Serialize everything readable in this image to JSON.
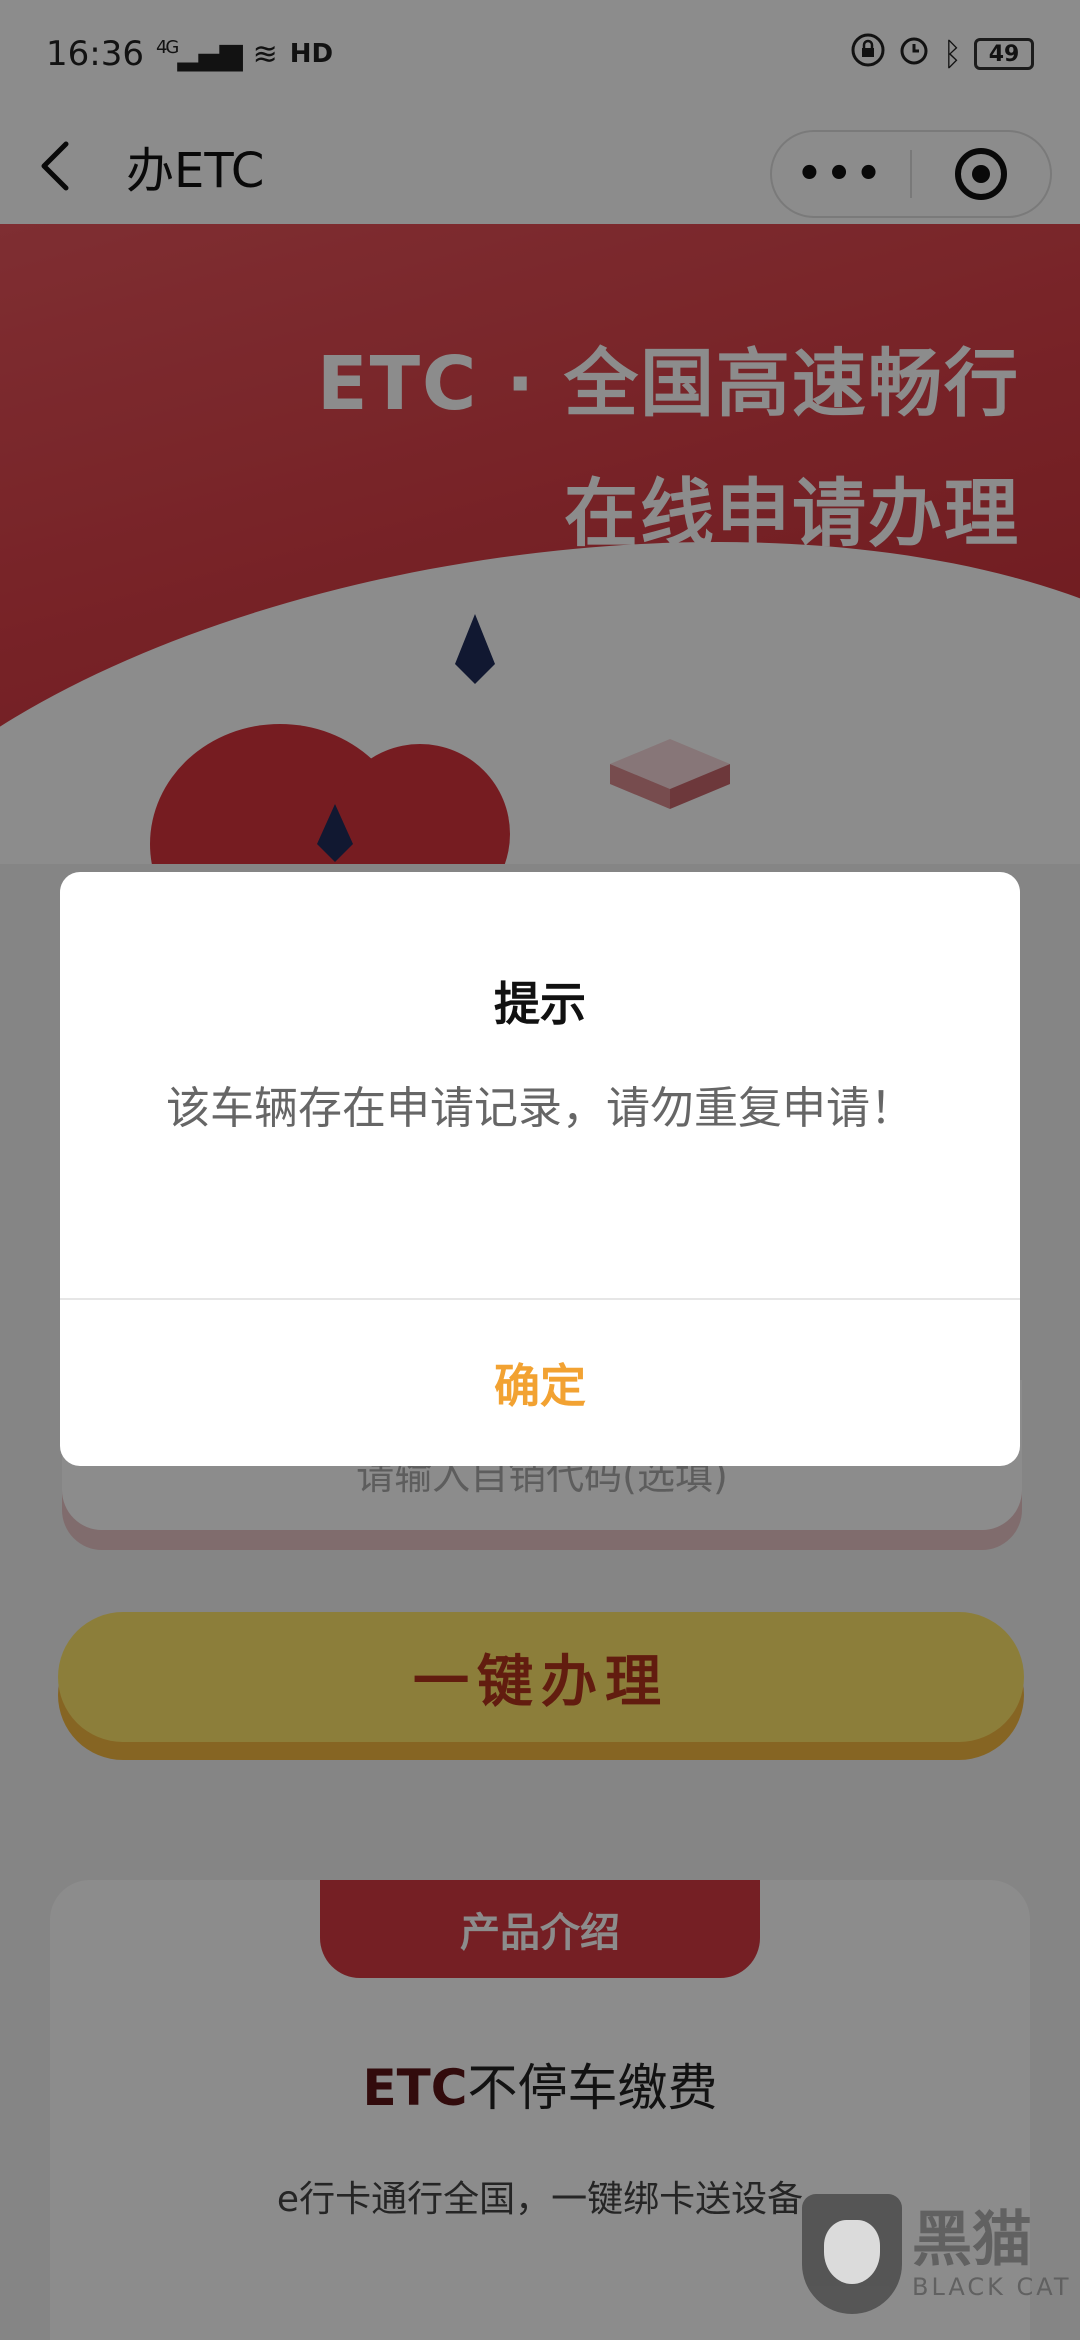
{
  "status_bar": {
    "time": "16:36",
    "network": "4G",
    "hd": "HD",
    "battery": "49"
  },
  "nav": {
    "title": "办ETC"
  },
  "hero": {
    "line1": "ETC · 全国高速畅行",
    "line2": "在线申请办理"
  },
  "form": {
    "hint": "请输入自销代码(选填)"
  },
  "apply_button": "一键办理",
  "intro": {
    "tab": "产品介绍",
    "heading_etc": "ETC",
    "heading_rest": "不停车缴费",
    "sub": "e行卡通行全国，一键绑卡送设备"
  },
  "modal": {
    "title": "提示",
    "body": "该车辆存在申请记录，请勿重复申请！",
    "confirm": "确定"
  },
  "watermark": {
    "cn": "黑猫",
    "en": "BLACK CAT"
  },
  "colors": {
    "hero_red": "#d93f47",
    "button_yellow": "#ffe66b",
    "confirm_orange": "#f2a232"
  }
}
